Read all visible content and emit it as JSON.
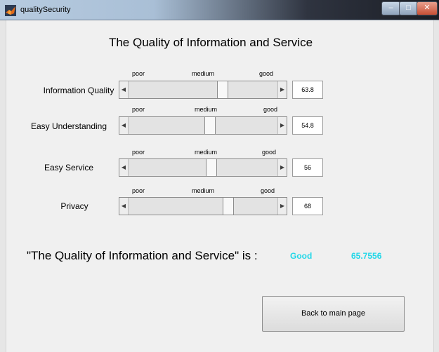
{
  "window": {
    "title": "qualitySecurity",
    "minimize_glyph": "–",
    "maximize_glyph": "□",
    "close_glyph": "✕",
    "icon": "matlab-icon"
  },
  "heading": "The Quality of Information and Service",
  "scale_labels": {
    "poor": "poor",
    "medium": "medium",
    "good": "good"
  },
  "arrows": {
    "left": "◀",
    "right": "▶"
  },
  "sliders": [
    {
      "label": "Information Quality",
      "value_text": "63.8",
      "value": 63.8
    },
    {
      "label": "Easy Understanding",
      "value_text": "54.8",
      "value": 54.8
    },
    {
      "label": "Easy Service",
      "value_text": "56",
      "value": 56
    },
    {
      "label": "Privacy",
      "value_text": "68",
      "value": 68
    }
  ],
  "result": {
    "question": "\"The Quality of Information and Service\" is :",
    "verdict": "Good",
    "score": "65.7556",
    "color": "#22d7e8"
  },
  "back_button": "Back to main page"
}
